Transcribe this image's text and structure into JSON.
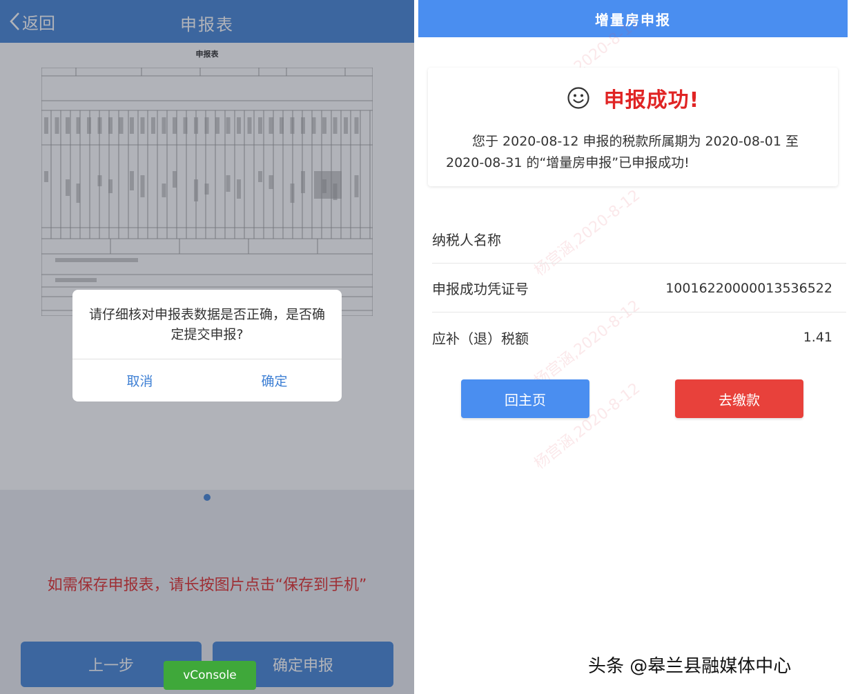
{
  "left_screen": {
    "header": {
      "back_label": "返回",
      "title": "申报表"
    },
    "form": {
      "title": "申报表"
    },
    "save_hint": "如需保存申报表，请长按图片点击“保存到手机”",
    "buttons": {
      "prev": "上一步",
      "confirm": "确定申报"
    },
    "vconsole_label": "vConsole",
    "dialog": {
      "message": "请仔细核对申报表数据是否正确，是否确定提交申报?",
      "cancel": "取消",
      "ok": "确定"
    },
    "colors": {
      "header": "#3d7fd4",
      "hint": "#e02424",
      "vconsole": "#3fa83a"
    }
  },
  "right_screen": {
    "header": {
      "title": "增量房申报"
    },
    "success": {
      "icon": "smile-icon",
      "title": "申报成功!",
      "message": "您于 2020-08-12 申报的税款所属期为 2020-08-01 至 2020-08-31 的“增量房申报”已申报成功!"
    },
    "info": [
      {
        "label": "纳税人名称",
        "value": ""
      },
      {
        "label": "申报成功凭证号",
        "value": "10016220000013536522"
      },
      {
        "label": "应补（退）税额",
        "value": "1.41"
      }
    ],
    "buttons": {
      "home": "回主页",
      "pay": "去缴款"
    },
    "watermark": "杨宫涵,2020-8-12",
    "colors": {
      "header": "#4a8ef0",
      "title": "#e02424",
      "pay": "#e8413b"
    }
  },
  "credit": "头条 @皋兰县融媒体中心"
}
